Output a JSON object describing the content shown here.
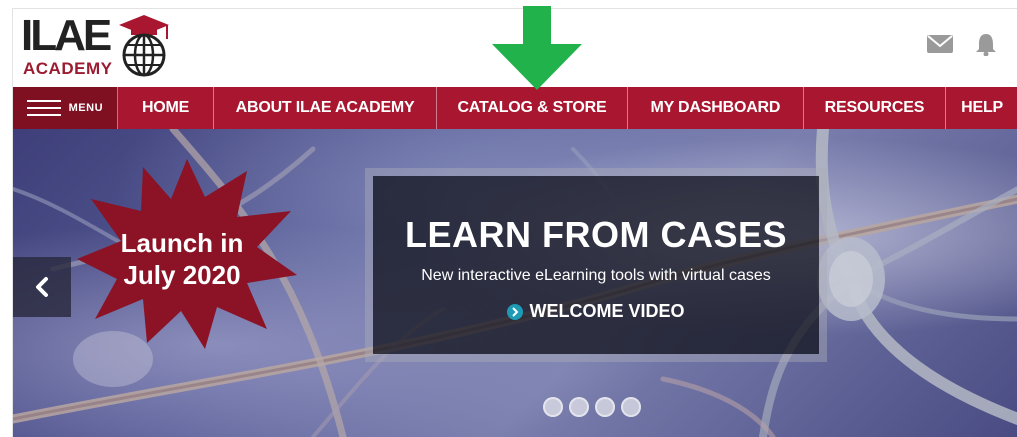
{
  "header": {
    "logo_main": "ILAE",
    "logo_sub": "ACADEMY",
    "icons": [
      "mail-icon",
      "bell-icon"
    ]
  },
  "nav": {
    "menu_label": "MENU",
    "items": [
      {
        "label": "HOME"
      },
      {
        "label": "ABOUT ILAE ACADEMY"
      },
      {
        "label": "CATALOG & STORE"
      },
      {
        "label": "MY DASHBOARD"
      },
      {
        "label": "RESOURCES"
      },
      {
        "label": "HELP"
      }
    ]
  },
  "hero": {
    "badge_line1": "Launch in",
    "badge_line2": "July 2020",
    "title": "LEARN FROM CASES",
    "subtitle": "New interactive eLearning tools with virtual cases",
    "video_label": "WELCOME VIDEO",
    "slide_count": 4
  },
  "colors": {
    "brand_red": "#a8172f",
    "menu_dark_red": "#7e1022",
    "annotation_green": "#22b24c",
    "play_accent": "#1e9ab5"
  }
}
